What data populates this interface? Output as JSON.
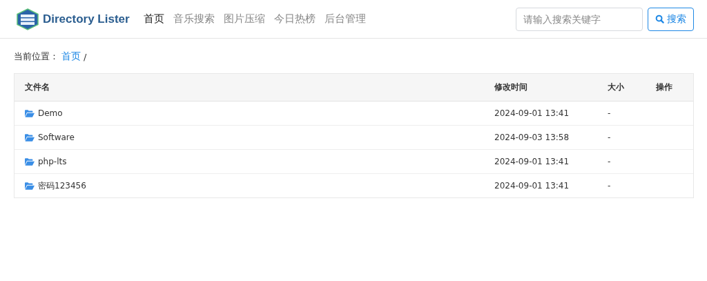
{
  "brand": {
    "name": "Directory Lister"
  },
  "nav": [
    {
      "label": "首页",
      "selected": true
    },
    {
      "label": "音乐搜索",
      "selected": false
    },
    {
      "label": "图片压缩",
      "selected": false
    },
    {
      "label": "今日热榜",
      "selected": false
    },
    {
      "label": "后台管理",
      "selected": false
    }
  ],
  "search": {
    "placeholder": "请输入搜索关键字",
    "button": "搜索"
  },
  "breadcrumb": {
    "label": "当前位置：",
    "items": [
      {
        "text": "首页"
      }
    ],
    "separator": "/"
  },
  "table": {
    "columns": [
      "文件名",
      "修改时间",
      "大小",
      "操作"
    ],
    "rows": [
      {
        "name": "Demo",
        "modified": "2024-09-01 13:41",
        "size": "-"
      },
      {
        "name": "Software",
        "modified": "2024-09-03 13:58",
        "size": "-"
      },
      {
        "name": "php-lts",
        "modified": "2024-09-01 13:41",
        "size": "-"
      },
      {
        "name": "密码123456",
        "modified": "2024-09-01 13:41",
        "size": "-"
      }
    ]
  }
}
